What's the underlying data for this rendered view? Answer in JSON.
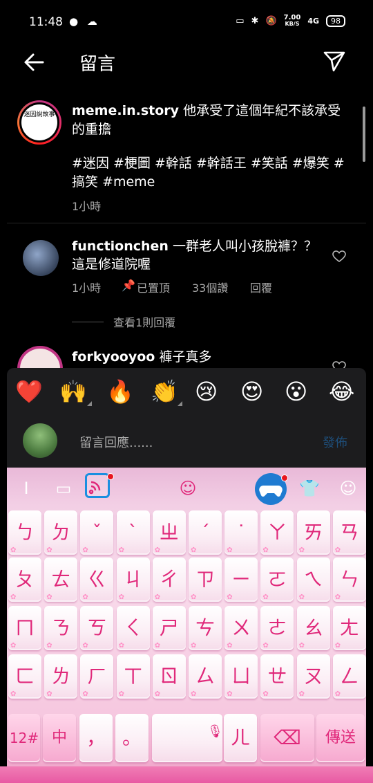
{
  "status_bar": {
    "time": "11:48",
    "net_speed_value": "7.00",
    "net_speed_unit": "KB/S",
    "signal": "4G",
    "battery": "98"
  },
  "header": {
    "title": "留言"
  },
  "caption": {
    "username": "meme.in.story",
    "text": " 他承受了這個年紀不該承受的重擔",
    "hashtags": "#迷因 #梗圖 #幹話 #幹話王 #笑話 #爆笑 #搞笑 #meme",
    "time": "1小時",
    "avatar_text": "迷因說故事"
  },
  "comments": [
    {
      "username": "functionchen",
      "text": " 一群老人叫小孩脫褲？？這是修道院喔",
      "time": "1小時",
      "pinned": "已置頂",
      "likes": "33個讚",
      "reply": "回覆",
      "view_replies": "查看1則回覆"
    },
    {
      "username": "forkyooyoo",
      "text": " 褲子真多"
    }
  ],
  "composer": {
    "emojis": [
      "❤️",
      "🙌",
      "🔥",
      "👏",
      "😢",
      "😍",
      "😮",
      "😂"
    ],
    "placeholder": "留言回應......",
    "post_label": "發佈"
  },
  "keyboard": {
    "rows": [
      [
        "ㄅ",
        "ㄉ",
        "ˇ",
        "ˋ",
        "ㄓ",
        "ˊ",
        "˙",
        "ㄚ",
        "ㄞ",
        "ㄢ"
      ],
      [
        "ㄆ",
        "ㄊ",
        "ㄍ",
        "ㄐ",
        "ㄔ",
        "ㄗ",
        "ㄧ",
        "ㄛ",
        "ㄟ",
        "ㄣ"
      ],
      [
        "ㄇ",
        "ㄋ",
        "ㄎ",
        "ㄑ",
        "ㄕ",
        "ㄘ",
        "ㄨ",
        "ㄜ",
        "ㄠ",
        "ㄤ"
      ],
      [
        "ㄈ",
        "ㄌ",
        "ㄏ",
        "ㄒ",
        "ㄖ",
        "ㄙ",
        "ㄩ",
        "ㄝ",
        "ㄡ",
        "ㄥ"
      ]
    ],
    "bottom": {
      "num_label": "12#",
      "lang_label": "中",
      "comma": "，",
      "period": "。",
      "er_key": "ㄦ",
      "send_label": "傳送"
    },
    "colors": {
      "key_text": "#e0287a",
      "accent": "#1f7bd1"
    }
  }
}
